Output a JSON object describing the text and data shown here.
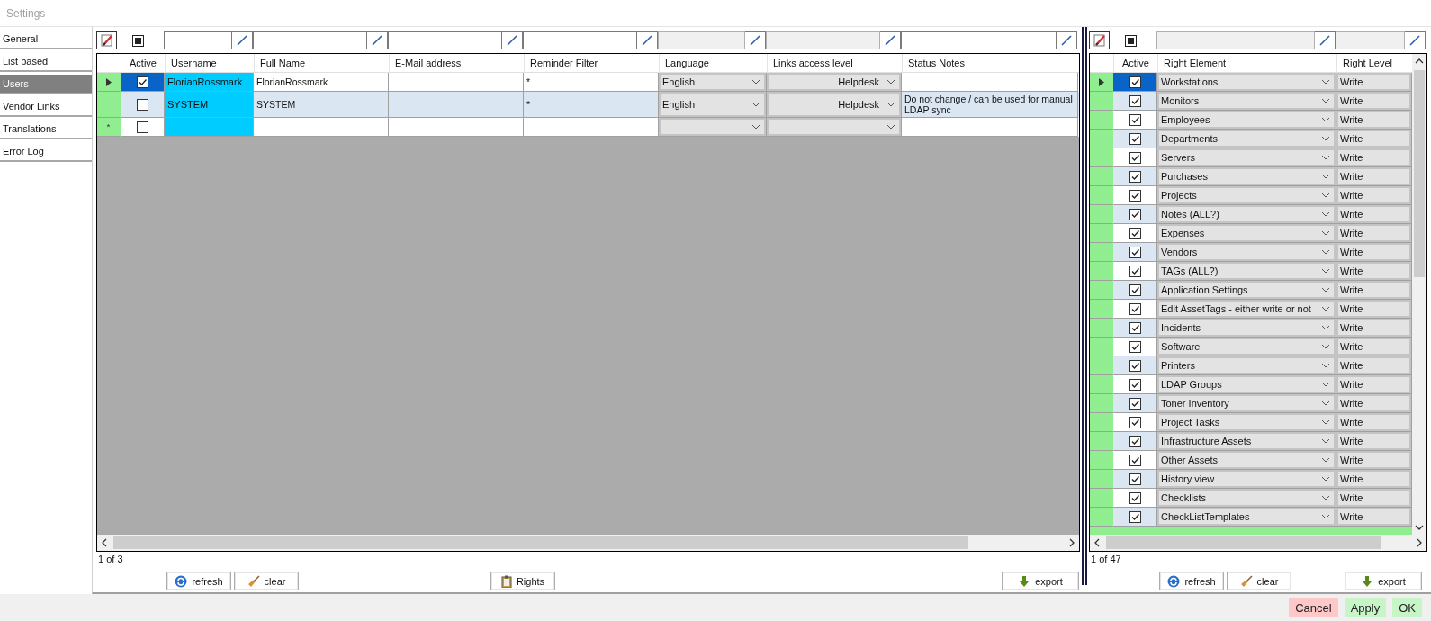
{
  "window": {
    "title": "Settings"
  },
  "sidebar": {
    "items": [
      {
        "label": "General",
        "selected": false
      },
      {
        "label": "List based",
        "selected": false
      },
      {
        "label": "Users",
        "selected": true
      },
      {
        "label": "Vendor Links",
        "selected": false
      },
      {
        "label": "Translations",
        "selected": false
      },
      {
        "label": "Error Log",
        "selected": false
      }
    ]
  },
  "users_grid": {
    "columns": [
      {
        "label": "Active",
        "kind": "check"
      },
      {
        "label": "Username",
        "kind": "key",
        "filter": {
          "disabled": false
        }
      },
      {
        "label": "Full Name",
        "kind": "text",
        "filter": {
          "disabled": false
        }
      },
      {
        "label": "E-Mail address",
        "kind": "text",
        "filter": {
          "disabled": false
        }
      },
      {
        "label": "Reminder Filter",
        "kind": "text",
        "filter": {
          "disabled": false
        }
      },
      {
        "label": "Language",
        "kind": "combo",
        "filter": {
          "disabled": true
        }
      },
      {
        "label": "Links access level",
        "kind": "combo-right",
        "filter": {
          "disabled": true
        }
      },
      {
        "label": "Status Notes",
        "kind": "text",
        "filter": {
          "disabled": false
        }
      }
    ],
    "rows": [
      {
        "kind": "data",
        "selected": true,
        "active": true,
        "username": "FlorianRossmark",
        "full_name": "FlorianRossmark",
        "reminder_filter": "*",
        "language": "English",
        "links_access_level": "Helpdesk"
      },
      {
        "kind": "data",
        "selected": false,
        "active": false,
        "username": "SYSTEM",
        "full_name": "SYSTEM",
        "reminder_filter": "*",
        "language": "English",
        "links_access_level": "Helpdesk",
        "status_notes": "Do not change / can be used for manual\nLDAP sync"
      },
      {
        "kind": "new",
        "selected": false,
        "active": false,
        "marker": "*"
      }
    ],
    "pager": "1 of 3",
    "buttons": [
      {
        "label": "refresh",
        "kind": "refresh"
      },
      {
        "label": "clear",
        "kind": "clear"
      },
      {
        "label": "Rights",
        "kind": "rights"
      },
      {
        "label": "export",
        "kind": "export"
      }
    ]
  },
  "rights_grid": {
    "columns": [
      {
        "label": "Active",
        "kind": "check"
      },
      {
        "label": "Right Element",
        "kind": "combo",
        "filter": {
          "disabled": true
        }
      },
      {
        "label": "Right Level",
        "kind": "level",
        "filter": {
          "disabled": true
        }
      }
    ],
    "rows": [
      {
        "selected": true,
        "active": true,
        "right_element": "Workstations",
        "right_level": "Write"
      },
      {
        "selected": false,
        "active": true,
        "right_element": "Monitors",
        "right_level": "Write"
      },
      {
        "selected": false,
        "active": true,
        "right_element": "Employees",
        "right_level": "Write"
      },
      {
        "selected": false,
        "active": true,
        "right_element": "Departments",
        "right_level": "Write"
      },
      {
        "selected": false,
        "active": true,
        "right_element": "Servers",
        "right_level": "Write"
      },
      {
        "selected": false,
        "active": true,
        "right_element": "Purchases",
        "right_level": "Write"
      },
      {
        "selected": false,
        "active": true,
        "right_element": "Projects",
        "right_level": "Write"
      },
      {
        "selected": false,
        "active": true,
        "right_element": "Notes (ALL?)",
        "right_level": "Write"
      },
      {
        "selected": false,
        "active": true,
        "right_element": "Expenses",
        "right_level": "Write"
      },
      {
        "selected": false,
        "active": true,
        "right_element": "Vendors",
        "right_level": "Write"
      },
      {
        "selected": false,
        "active": true,
        "right_element": "TAGs (ALL?)",
        "right_level": "Write"
      },
      {
        "selected": false,
        "active": true,
        "right_element": "Application Settings",
        "right_level": "Write"
      },
      {
        "selected": false,
        "active": true,
        "right_element": "Edit AssetTags - either write or not",
        "right_level": "Write"
      },
      {
        "selected": false,
        "active": true,
        "right_element": "Incidents",
        "right_level": "Write"
      },
      {
        "selected": false,
        "active": true,
        "right_element": "Software",
        "right_level": "Write"
      },
      {
        "selected": false,
        "active": true,
        "right_element": "Printers",
        "right_level": "Write"
      },
      {
        "selected": false,
        "active": true,
        "right_element": "LDAP Groups",
        "right_level": "Write"
      },
      {
        "selected": false,
        "active": true,
        "right_element": "Toner Inventory",
        "right_level": "Write"
      },
      {
        "selected": false,
        "active": true,
        "right_element": "Project Tasks",
        "right_level": "Write"
      },
      {
        "selected": false,
        "active": true,
        "right_element": "Infrastructure Assets",
        "right_level": "Write"
      },
      {
        "selected": false,
        "active": true,
        "right_element": "Other Assets",
        "right_level": "Write"
      },
      {
        "selected": false,
        "active": true,
        "right_element": "History view",
        "right_level": "Write"
      },
      {
        "selected": false,
        "active": true,
        "right_element": "Checklists",
        "right_level": "Write"
      },
      {
        "selected": false,
        "active": true,
        "right_element": "CheckListTemplates",
        "right_level": "Write"
      }
    ],
    "pager": "1 of 47",
    "buttons": [
      {
        "label": "refresh",
        "kind": "refresh"
      },
      {
        "label": "clear",
        "kind": "clear"
      },
      {
        "label": "export",
        "kind": "export"
      }
    ]
  },
  "dialog_buttons": [
    {
      "label": "Cancel",
      "kind": "cancel"
    },
    {
      "label": "Apply",
      "kind": "confirm"
    },
    {
      "label": "OK",
      "kind": "confirm"
    }
  ]
}
